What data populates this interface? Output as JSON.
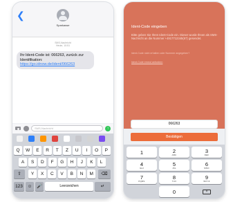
{
  "messages_app": {
    "sender": "Sparkasse",
    "timestamp_line1": "SMS-Nachricht",
    "timestamp_line2": "Heute, 10:51",
    "message_text": "Ihr Ident-Code ist: 066263, zurück zur Identifikation:",
    "message_link": "https://go.idnow.de/ident/066263",
    "compose_placeholder": "SMS-Nachricht",
    "app_icon_colors": [
      "#f2f2f2",
      "#2d7ff9",
      "#ff9500",
      "#e0443e",
      "#ffffff",
      "#c7c7cc",
      "#d4d4d4",
      "#7a4df0"
    ],
    "keyboard": {
      "row1": [
        "Q",
        "W",
        "E",
        "R",
        "T",
        "Z",
        "U",
        "I",
        "O",
        "P"
      ],
      "row2": [
        "A",
        "S",
        "D",
        "F",
        "G",
        "H",
        "J",
        "K",
        "L"
      ],
      "row3": [
        "Y",
        "X",
        "C",
        "V",
        "B",
        "N",
        "M"
      ],
      "shift": "⇧",
      "backspace": "⌫",
      "numbers": "123",
      "emoji": "☺",
      "mic": "🎤",
      "space": "Leerzeichen",
      "return": "↵"
    }
  },
  "ident_app": {
    "title": "Ident-Code eingeben",
    "instruction": "Bitte geben Sie Ihren Ident-Code ein. Dieser wurde Ihnen als SMS-Nachricht an die Nummer +4917712345(67) gesendet.",
    "hint": "Ident-Code nicht erhalten oder Nummer angegeben?",
    "resend_link": "Ident-Code erneut anfordern",
    "code_value": "066263",
    "confirm_label": "Bestätigen",
    "accent_color": "#ec6c3a",
    "numpad": [
      {
        "digit": "1",
        "letters": ""
      },
      {
        "digit": "2",
        "letters": "ABC"
      },
      {
        "digit": "3",
        "letters": "DEF"
      },
      {
        "digit": "4",
        "letters": "GHI"
      },
      {
        "digit": "5",
        "letters": "JKL"
      },
      {
        "digit": "6",
        "letters": "MNO"
      },
      {
        "digit": "7",
        "letters": "PQRS"
      },
      {
        "digit": "8",
        "letters": "TUV"
      },
      {
        "digit": "9",
        "letters": "WXYZ"
      },
      {
        "digit": "0",
        "letters": ""
      }
    ],
    "delete_symbol": "⌫"
  }
}
